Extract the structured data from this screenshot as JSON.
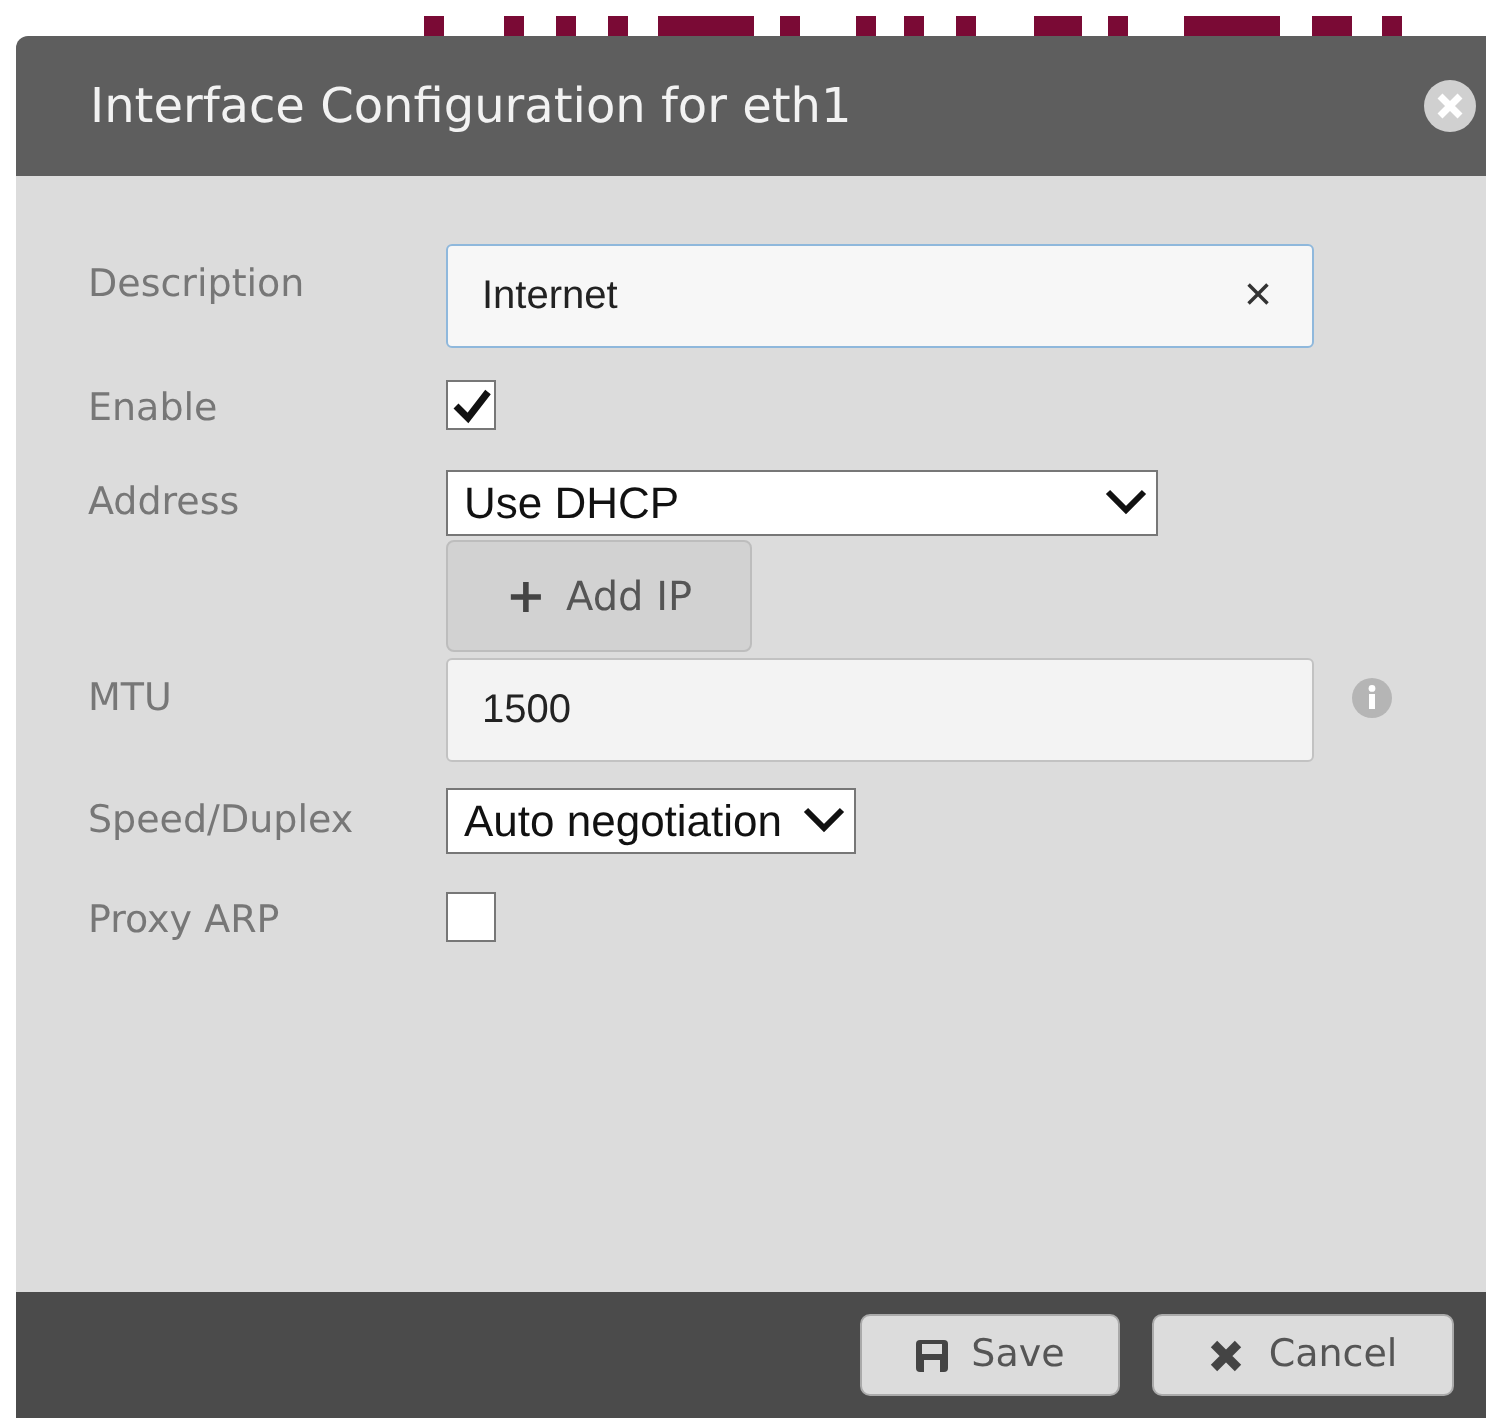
{
  "dialog": {
    "title": "Interface Configuration for eth1"
  },
  "fields": [
    {
      "kind": "text",
      "label": "Description",
      "value": "Internet",
      "clear": "×"
    },
    {
      "kind": "checkbox",
      "label": "Enable",
      "checked": true
    },
    {
      "kind": "select",
      "label": "Address",
      "value": "Use DHCP",
      "button": {
        "icon": "+",
        "label": "Add IP"
      }
    },
    {
      "kind": "text",
      "label": "MTU",
      "value": "1500",
      "info": true
    },
    {
      "kind": "select",
      "label": "Speed/Duplex",
      "value": "Auto negotiation"
    },
    {
      "kind": "checkbox",
      "label": "Proxy ARP",
      "checked": false
    }
  ],
  "buttons": [
    {
      "kind": "save",
      "label": "Save"
    },
    {
      "kind": "cancel",
      "label": "Cancel"
    }
  ]
}
